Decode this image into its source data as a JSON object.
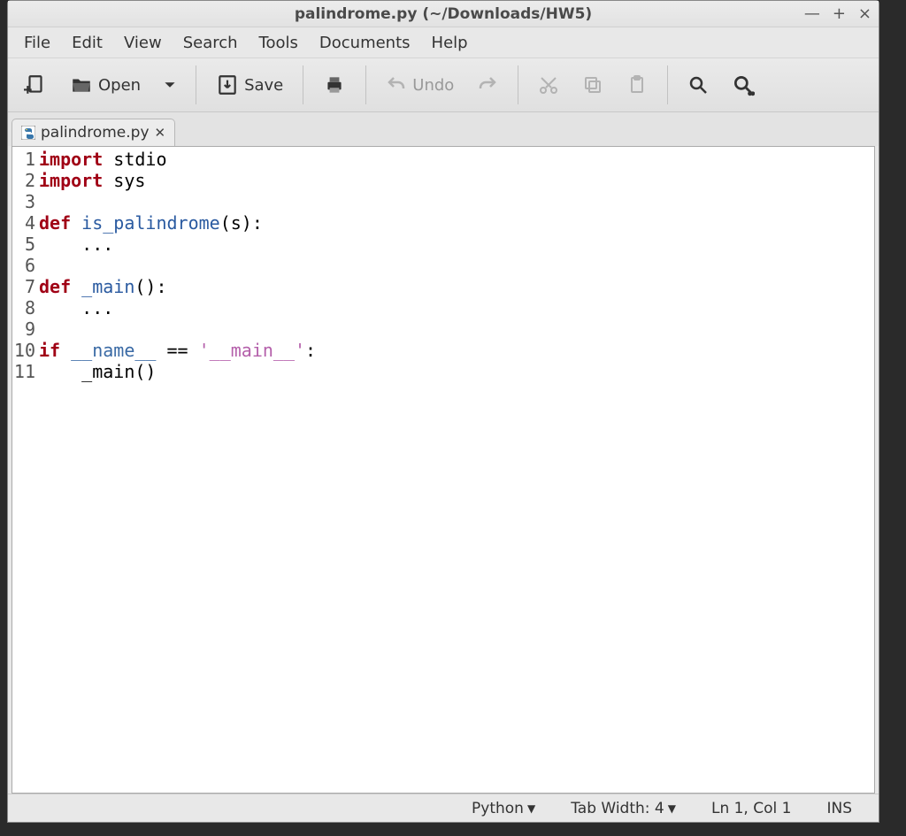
{
  "title": "palindrome.py (~/Downloads/HW5)",
  "menus": [
    "File",
    "Edit",
    "View",
    "Search",
    "Tools",
    "Documents",
    "Help"
  ],
  "toolbar": {
    "open": "Open",
    "save": "Save",
    "undo": "Undo"
  },
  "tab": {
    "label": "palindrome.py"
  },
  "code": {
    "lines": [
      {
        "n": "1",
        "tokens": [
          {
            "t": "import ",
            "c": "kw"
          },
          {
            "t": "stdio",
            "c": ""
          }
        ]
      },
      {
        "n": "2",
        "tokens": [
          {
            "t": "import ",
            "c": "kw"
          },
          {
            "t": "sys",
            "c": ""
          }
        ]
      },
      {
        "n": "3",
        "tokens": [
          {
            "t": "",
            "c": ""
          }
        ]
      },
      {
        "n": "4",
        "tokens": [
          {
            "t": "def ",
            "c": "kw"
          },
          {
            "t": "is_palindrome",
            "c": "fn"
          },
          {
            "t": "(s):",
            "c": ""
          }
        ]
      },
      {
        "n": "5",
        "tokens": [
          {
            "t": "    ...",
            "c": ""
          }
        ]
      },
      {
        "n": "6",
        "tokens": [
          {
            "t": "",
            "c": ""
          }
        ]
      },
      {
        "n": "7",
        "tokens": [
          {
            "t": "def ",
            "c": "kw"
          },
          {
            "t": "_main",
            "c": "fn"
          },
          {
            "t": "():",
            "c": ""
          }
        ]
      },
      {
        "n": "8",
        "tokens": [
          {
            "t": "    ...",
            "c": ""
          }
        ]
      },
      {
        "n": "9",
        "tokens": [
          {
            "t": "",
            "c": ""
          }
        ]
      },
      {
        "n": "10",
        "tokens": [
          {
            "t": "if ",
            "c": "kw"
          },
          {
            "t": "__name__",
            "c": "var"
          },
          {
            "t": " == ",
            "c": ""
          },
          {
            "t": "'__main__'",
            "c": "str"
          },
          {
            "t": ":",
            "c": ""
          }
        ]
      },
      {
        "n": "11",
        "tokens": [
          {
            "t": "    _main()",
            "c": ""
          }
        ]
      }
    ]
  },
  "status": {
    "language": "Python",
    "tabwidth_label": "Tab Width: 4",
    "position": "Ln 1, Col 1",
    "mode": "INS"
  }
}
